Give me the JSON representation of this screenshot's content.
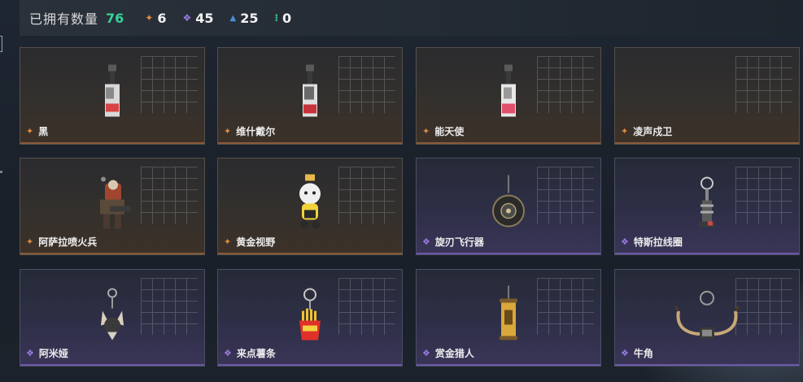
{
  "header": {
    "owned_label": "已拥有数量",
    "owned_count": "76",
    "stats": [
      {
        "icon": "orange-diamond-icon",
        "glyph": "✦",
        "color": "#e08a3c",
        "value": "6"
      },
      {
        "icon": "purple-diamond-icon",
        "glyph": "❖",
        "color": "#9b7be0",
        "value": "45"
      },
      {
        "icon": "blue-arrow-icon",
        "glyph": "▲",
        "color": "#4a90d9",
        "value": "25"
      },
      {
        "icon": "green-dots-icon",
        "glyph": "⁝",
        "color": "#3cc48c",
        "value": "0"
      }
    ]
  },
  "colors": {
    "orange": "#e08a3c",
    "purple": "#9b7be0",
    "count_green": "#34d399"
  },
  "cards": [
    {
      "name": "黑",
      "rarity": "orange",
      "item": "vial-keychain"
    },
    {
      "name": "维什戴尔",
      "rarity": "orange",
      "item": "vial-keychain"
    },
    {
      "name": "能天使",
      "rarity": "orange",
      "item": "vial-keychain"
    },
    {
      "name": "凌声戍卫",
      "rarity": "orange",
      "item": "none"
    },
    {
      "name": "阿萨拉喷火兵",
      "rarity": "orange",
      "item": "soldier-figure"
    },
    {
      "name": "黄金视野",
      "rarity": "orange",
      "item": "mascot-figure"
    },
    {
      "name": "旋刃飞行器",
      "rarity": "purple",
      "item": "round-drone"
    },
    {
      "name": "特斯拉线圈",
      "rarity": "purple",
      "item": "coil-keychain"
    },
    {
      "name": "阿米娅",
      "rarity": "purple",
      "item": "rabbit-keychain"
    },
    {
      "name": "来点薯条",
      "rarity": "purple",
      "item": "fries-keychain"
    },
    {
      "name": "赏金猎人",
      "rarity": "purple",
      "item": "scroll-keychain"
    },
    {
      "name": "牛角",
      "rarity": "purple",
      "item": "horns-necklace"
    }
  ]
}
